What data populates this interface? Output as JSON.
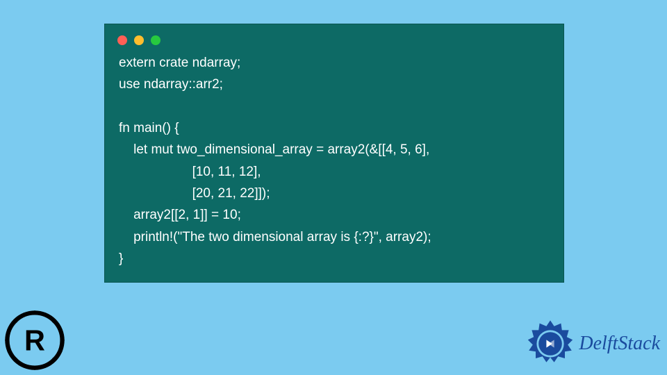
{
  "code": {
    "lines": [
      "extern crate ndarray;",
      "use ndarray::arr2;",
      "",
      "fn main() {",
      "    let mut two_dimensional_array = array2(&[[4, 5, 6],",
      "                    [10, 11, 12],",
      "                    [20, 21, 22]]);",
      "    array2[[2, 1]] = 10;",
      "    println!(\"The two dimensional array is {:?}\", array2);",
      "}"
    ]
  },
  "brand": {
    "name": "DelftStack"
  },
  "colors": {
    "bg": "#7bcbf0",
    "panel": "#0d6a65",
    "text": "#ffffff",
    "brand": "#1a4b9e"
  }
}
